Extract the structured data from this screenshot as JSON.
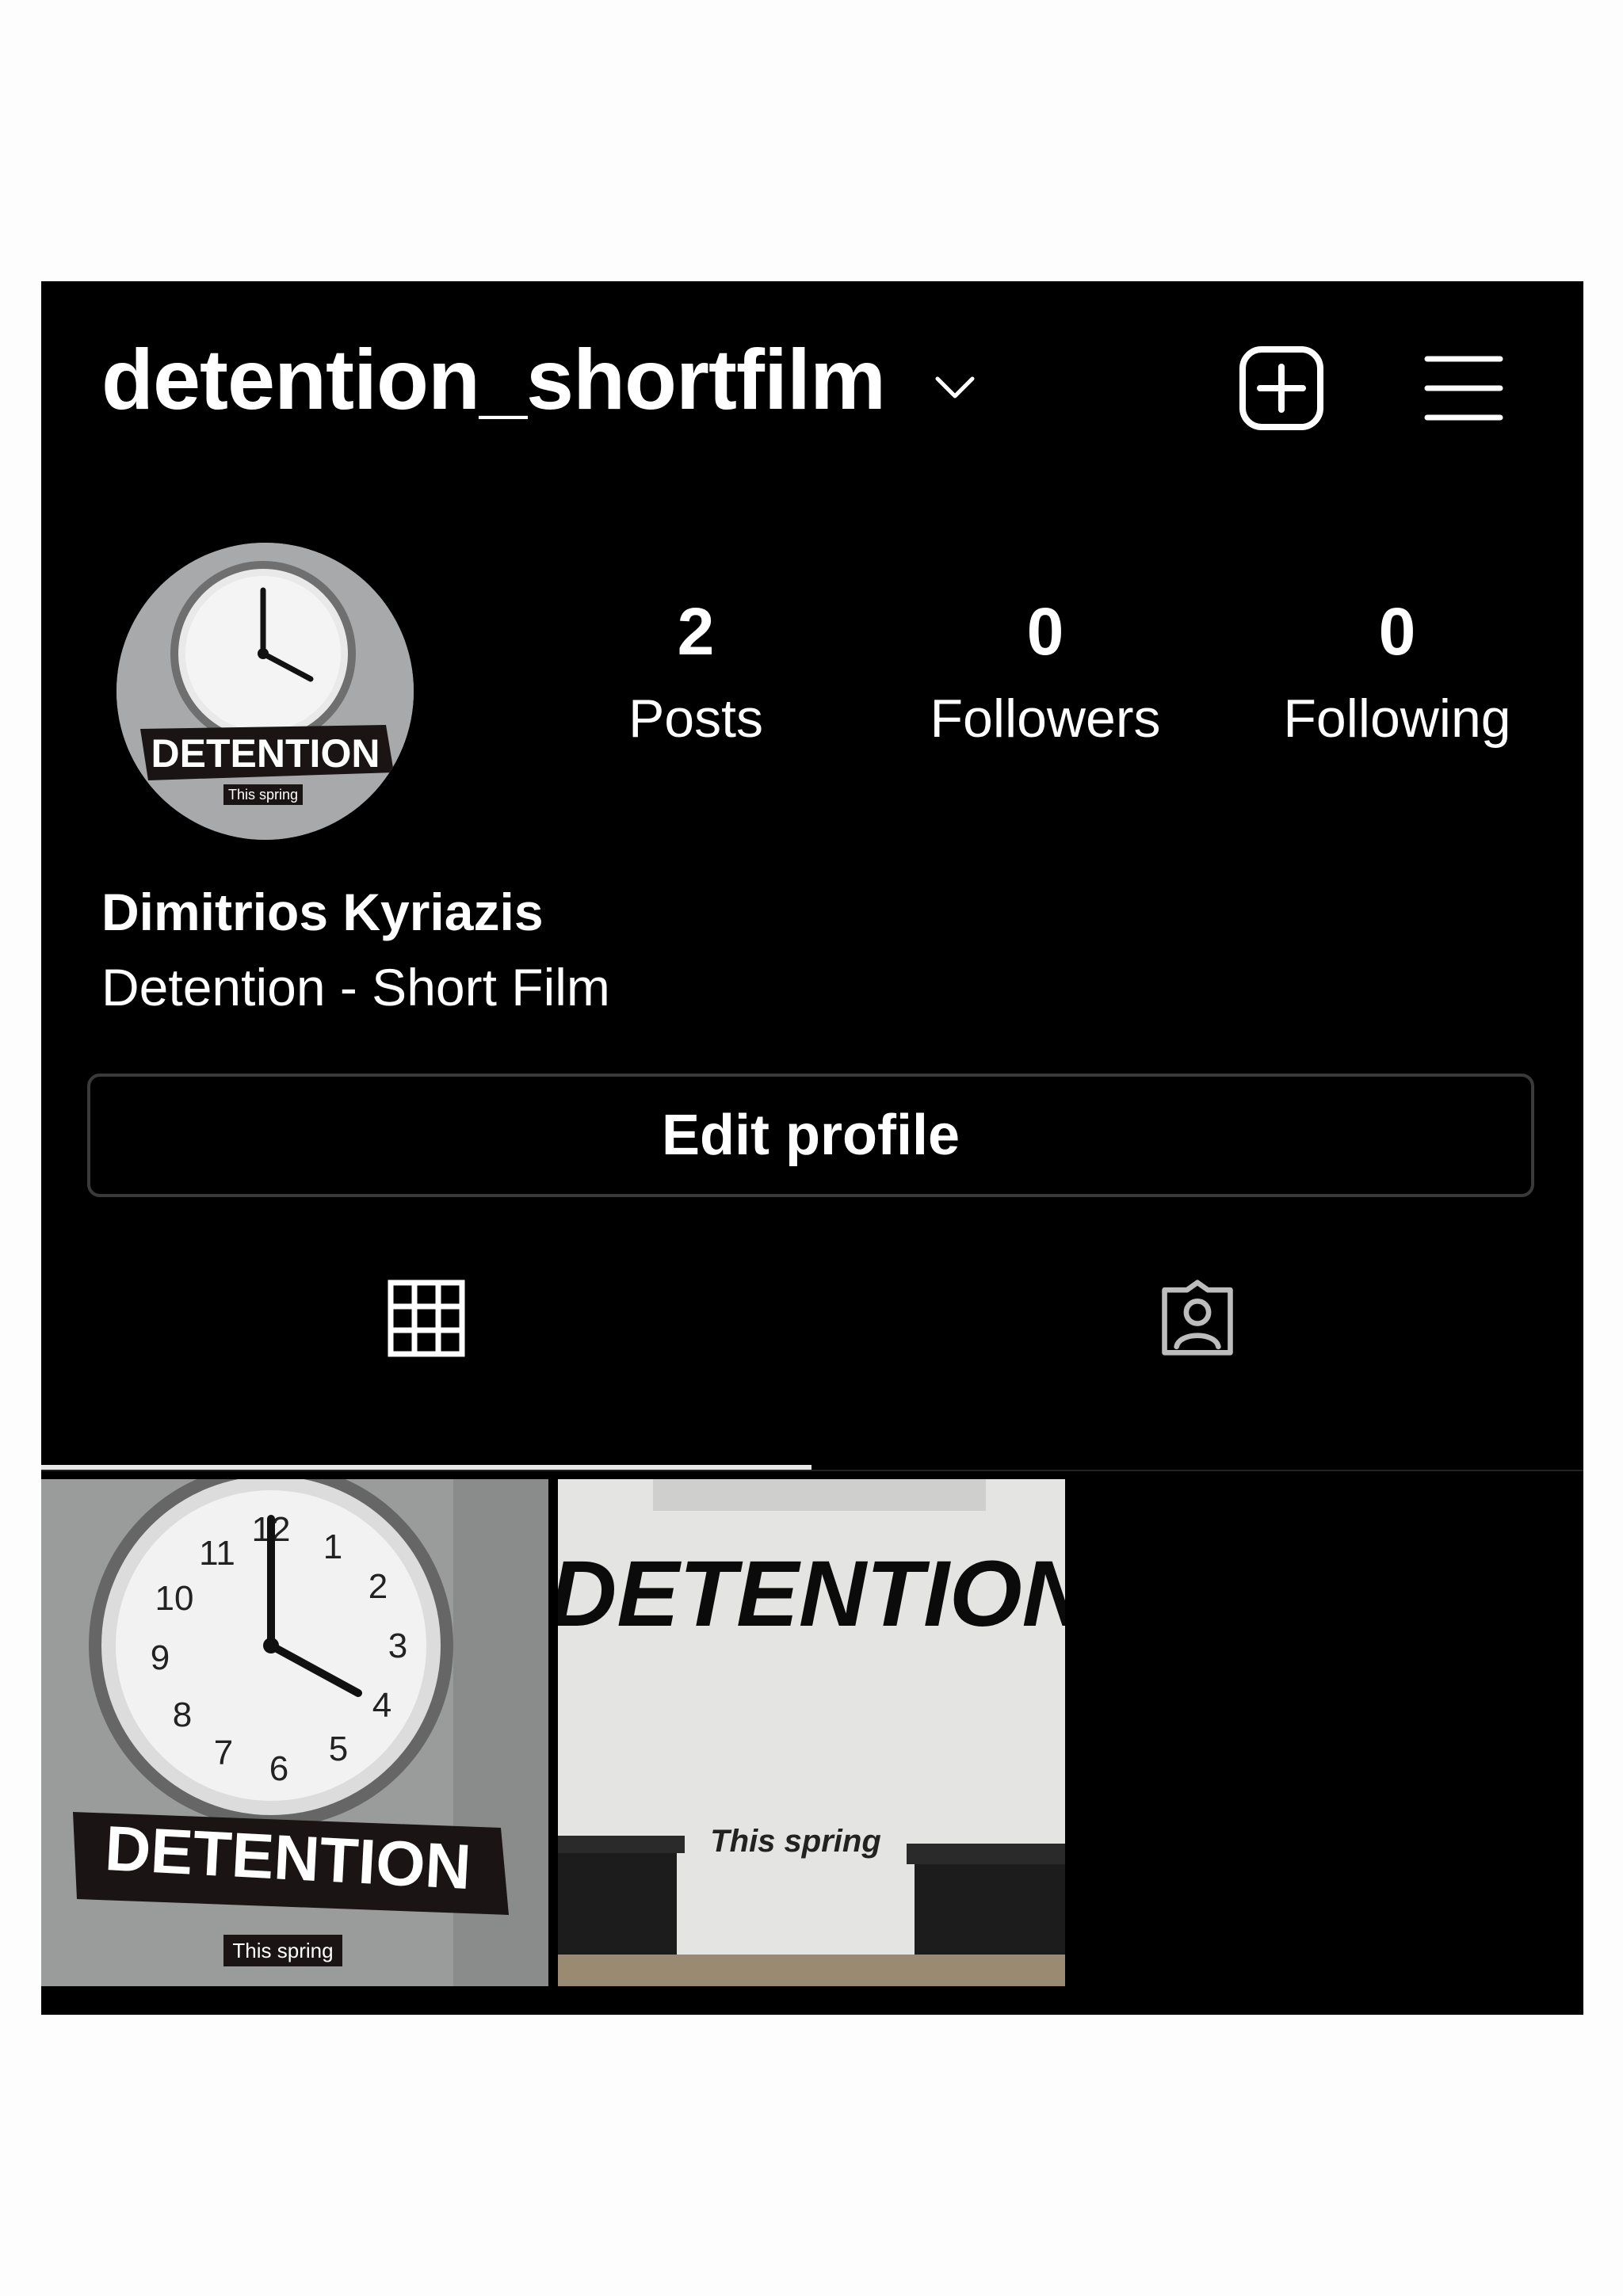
{
  "header": {
    "username": "detention_shortfilm",
    "icons": [
      "chevron-down-icon",
      "new-post-icon",
      "menu-icon"
    ]
  },
  "profile": {
    "avatar_text": "DETENTION",
    "avatar_subtext": "This spring",
    "stats": [
      {
        "value": "2",
        "label": "Posts"
      },
      {
        "value": "0",
        "label": "Followers"
      },
      {
        "value": "0",
        "label": "Following"
      }
    ],
    "name": "Dimitrios Kyriazis",
    "bio": "Detention - Short Film",
    "edit_button": "Edit profile"
  },
  "tabs": [
    {
      "icon": "grid-icon",
      "selected": true
    },
    {
      "icon": "tagged-icon",
      "selected": false
    }
  ],
  "posts": [
    {
      "title": "DETENTION",
      "subtitle": "This spring"
    },
    {
      "title": "DETENTION",
      "subtitle": "This spring"
    }
  ],
  "colors": {
    "background": "#000000",
    "text": "#ffffff",
    "border": "#3a3a3a",
    "page": "#fdfdfd"
  }
}
